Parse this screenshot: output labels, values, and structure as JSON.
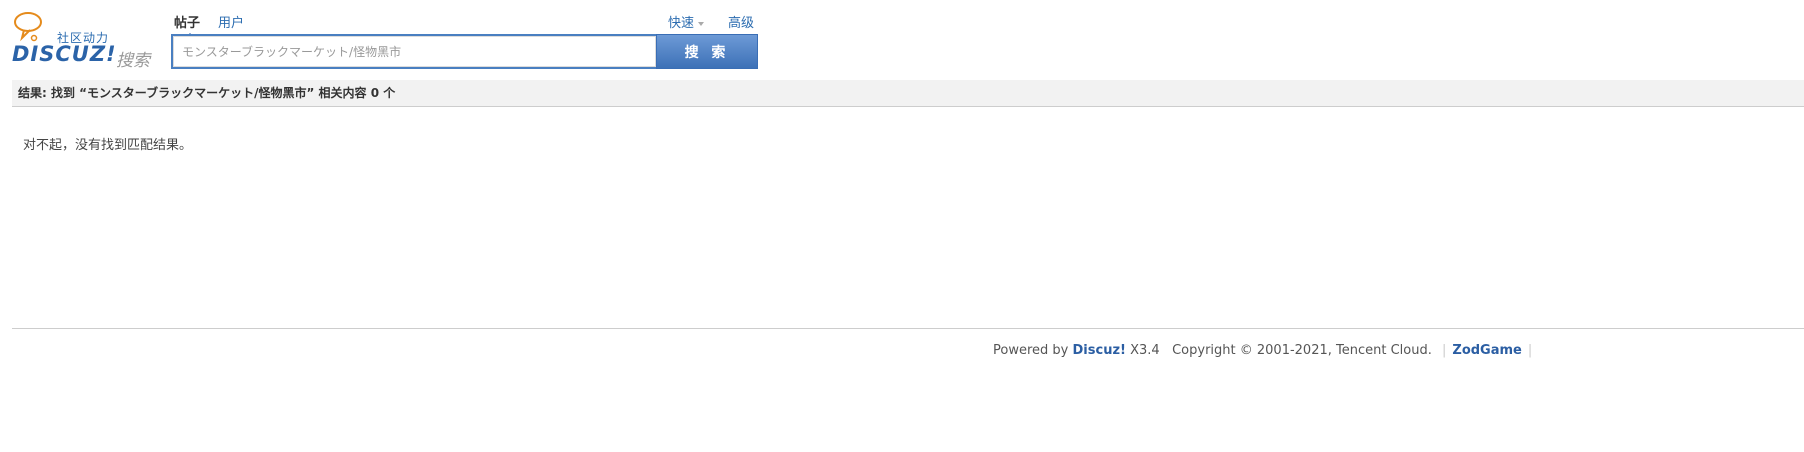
{
  "logo": {
    "slogan": "社区动力",
    "brand": "DISCUZ!",
    "search_text": "搜索"
  },
  "search_types": {
    "active": "帖子",
    "other": "用户"
  },
  "top_links": {
    "fast": "快速",
    "advanced": "高级"
  },
  "search": {
    "value": "モンスターブラックマーケット/怪物黑市",
    "button_label": "搜 索"
  },
  "result": {
    "summary": "结果: 找到 “モンスターブラックマーケット/怪物黑市” 相关内容 0 个",
    "empty_message": "对不起，没有找到匹配结果。"
  },
  "footer": {
    "powered_by": "Powered by",
    "brand": "Discuz!",
    "version": "X3.4",
    "copyright": "Copyright © 2001-2021, Tencent Cloud.",
    "site_link": "ZodGame"
  },
  "colors": {
    "link": "#2b6cb0",
    "button_bg": "#3d71b7",
    "result_bar_bg": "#f2f2f2"
  }
}
